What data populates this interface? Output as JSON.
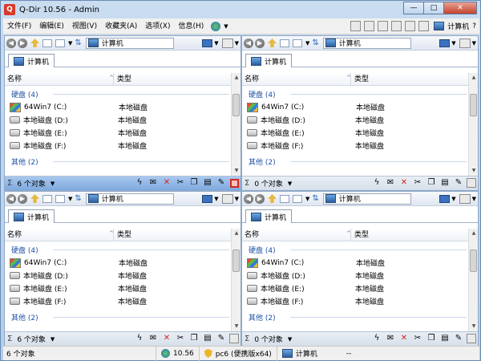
{
  "window": {
    "title": "Q-Dir 10.56 - Admin",
    "app_icon": "Q"
  },
  "window_controls": {
    "minimize": "—",
    "maximize": "□",
    "close": "✕"
  },
  "menubar": {
    "items": [
      "文件(F)",
      "编辑(E)",
      "视图(V)",
      "收藏夹(A)",
      "选项(X)",
      "信息(H)"
    ],
    "location_label": "计算机"
  },
  "panes": [
    {
      "address": "计算机",
      "tab": "计算机",
      "columns": {
        "name": "名称",
        "type": "类型"
      },
      "groups": [
        {
          "label": "硬盘 (4)",
          "rows": [
            {
              "name": "64Win7  (C:)",
              "type": "本地磁盘",
              "icon": "win-drive"
            },
            {
              "name": "本地磁盘 (D:)",
              "type": "本地磁盘",
              "icon": "drive"
            },
            {
              "name": "本地磁盘 (E:)",
              "type": "本地磁盘",
              "icon": "drive"
            },
            {
              "name": "本地磁盘 (F:)",
              "type": "本地磁盘",
              "icon": "drive"
            }
          ]
        },
        {
          "label": "其他 (2)",
          "rows": []
        }
      ],
      "status": {
        "sigma": "Σ",
        "count": "6 个对象",
        "active": true
      }
    },
    {
      "address": "计算机",
      "tab": "计算机",
      "columns": {
        "name": "名称",
        "type": "类型"
      },
      "groups": [
        {
          "label": "硬盘 (4)",
          "rows": [
            {
              "name": "64Win7  (C:)",
              "type": "本地磁盘",
              "icon": "win-drive"
            },
            {
              "name": "本地磁盘 (D:)",
              "type": "本地磁盘",
              "icon": "drive"
            },
            {
              "name": "本地磁盘 (E:)",
              "type": "本地磁盘",
              "icon": "drive"
            },
            {
              "name": "本地磁盘 (F:)",
              "type": "本地磁盘",
              "icon": "drive"
            }
          ]
        },
        {
          "label": "其他 (2)",
          "rows": []
        }
      ],
      "status": {
        "sigma": "Σ",
        "count": "0 个对象",
        "active": false
      }
    },
    {
      "address": "计算机",
      "tab": "计算机",
      "columns": {
        "name": "名称",
        "type": "类型"
      },
      "groups": [
        {
          "label": "硬盘 (4)",
          "rows": [
            {
              "name": "64Win7  (C:)",
              "type": "本地磁盘",
              "icon": "win-drive"
            },
            {
              "name": "本地磁盘 (D:)",
              "type": "本地磁盘",
              "icon": "drive"
            },
            {
              "name": "本地磁盘 (E:)",
              "type": "本地磁盘",
              "icon": "drive"
            },
            {
              "name": "本地磁盘 (F:)",
              "type": "本地磁盘",
              "icon": "drive"
            }
          ]
        },
        {
          "label": "其他 (2)",
          "rows": []
        }
      ],
      "status": {
        "sigma": "Σ",
        "count": "6 个对象",
        "active": false
      }
    },
    {
      "address": "计算机",
      "tab": "计算机",
      "columns": {
        "name": "名称",
        "type": "类型"
      },
      "groups": [
        {
          "label": "硬盘 (4)",
          "rows": [
            {
              "name": "64Win7  (C:)",
              "type": "本地磁盘",
              "icon": "win-drive"
            },
            {
              "name": "本地磁盘 (D:)",
              "type": "本地磁盘",
              "icon": "drive"
            },
            {
              "name": "本地磁盘 (E:)",
              "type": "本地磁盘",
              "icon": "drive"
            },
            {
              "name": "本地磁盘 (F:)",
              "type": "本地磁盘",
              "icon": "drive"
            }
          ]
        },
        {
          "label": "其他 (2)",
          "rows": []
        }
      ],
      "status": {
        "sigma": "Σ",
        "count": "0 个对象",
        "active": false
      }
    }
  ],
  "main_status": {
    "left": "6 个对象",
    "version": "10.56",
    "edition": "pc6 (便携版x64)",
    "location": "计算机",
    "dash": "--"
  },
  "colors": {
    "active_status": "#7fa9de",
    "group_header": "#1e4fa6",
    "close_red": "#c4432c"
  }
}
